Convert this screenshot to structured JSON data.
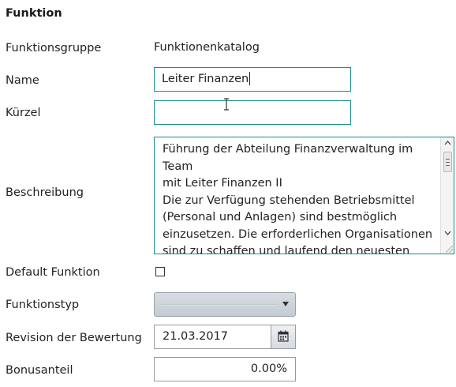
{
  "form": {
    "title": "Funktion",
    "funktionsgruppe": {
      "label": "Funktionsgruppe",
      "value": "Funktionenkatalog"
    },
    "name": {
      "label": "Name",
      "value": "Leiter Finanzen"
    },
    "kuerzel": {
      "label": "Kürzel",
      "value": ""
    },
    "beschreibung": {
      "label": "Beschreibung",
      "value": "Führung der Abteilung Finanzverwaltung im Team\nmit Leiter Finanzen II\nDie zur Verfügung stehenden Betriebsmittel\n(Personal und Anlagen) sind bestmöglich\neinzusetzen. Die erforderlichen Organisationen\nsind zu schaffen und laufend den neuesten\nErkenntnissen und Anforderungen anzupassen."
    },
    "default_funktion": {
      "label": "Default Funktion",
      "checked": false
    },
    "funktionstyp": {
      "label": "Funktionstyp",
      "value": ""
    },
    "revision": {
      "label": "Revision der Bewertung",
      "value": "21.03.2017"
    },
    "bonusanteil": {
      "label": "Bonusanteil",
      "value": "0.00%"
    }
  },
  "icons": {
    "calendar": "calendar-icon",
    "dropdown": "chevron-down-icon",
    "scroll_up": "scroll-up-arrow-icon",
    "scroll_down": "scroll-down-arrow-icon",
    "cursor": "text-cursor-icon"
  },
  "colors": {
    "focus_border": "#1f8a8a",
    "field_border": "#9a9a9a",
    "select_fill": "#c9d0d8"
  }
}
